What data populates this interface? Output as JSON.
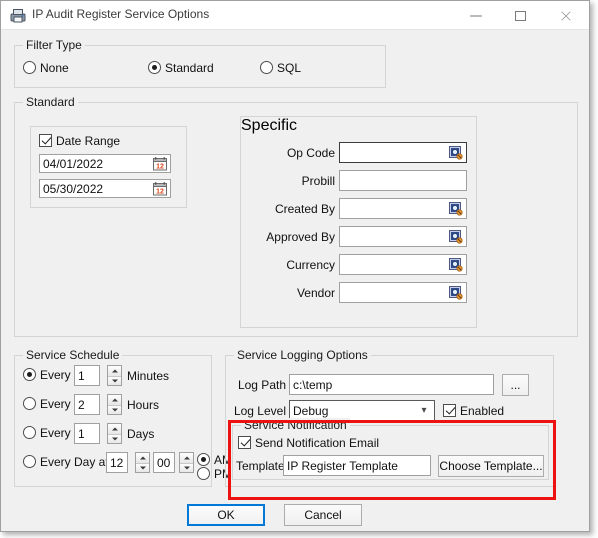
{
  "window": {
    "title": "IP Audit Register Service Options",
    "icon": "printer-icon",
    "minimize_label": "Minimize",
    "maximize_label": "Maximize",
    "close_label": "Close"
  },
  "filter_type": {
    "legend": "Filter Type",
    "options": [
      {
        "label": "None",
        "selected": false
      },
      {
        "label": "Standard",
        "selected": true
      },
      {
        "label": "SQL",
        "selected": false
      }
    ]
  },
  "standard": {
    "legend": "Standard",
    "date_range": {
      "checkbox_label": "Date Range",
      "checked": true,
      "from": "04/01/2022",
      "to": "05/30/2022",
      "icon": "calendar-icon"
    },
    "specific": {
      "legend": "Specific",
      "fields": [
        {
          "label": "Op Code",
          "value": "",
          "icon": "lookup-icon",
          "focused": true
        },
        {
          "label": "Probill",
          "value": "",
          "icon": "",
          "focused": false
        },
        {
          "label": "Created By",
          "value": "",
          "icon": "lookup-icon",
          "focused": false
        },
        {
          "label": "Approved By",
          "value": "",
          "icon": "lookup-icon",
          "focused": false
        },
        {
          "label": "Currency",
          "value": "",
          "icon": "lookup-icon",
          "focused": false
        },
        {
          "label": "Vendor",
          "value": "",
          "icon": "lookup-icon",
          "focused": false
        }
      ]
    }
  },
  "service_schedule": {
    "legend": "Service Schedule",
    "rows": [
      {
        "prefix": "Every",
        "value": "1",
        "unit": "Minutes",
        "selected": true
      },
      {
        "prefix": "Every",
        "value": "2",
        "unit": "Hours",
        "selected": false
      },
      {
        "prefix": "Every",
        "value": "1",
        "unit": "Days",
        "selected": false
      }
    ],
    "every_day": {
      "prefix": "Every Day at",
      "selected": false,
      "hour": "12",
      "minute": "00",
      "am_label": "AM",
      "pm_label": "PM",
      "meridiem": "AM"
    }
  },
  "logging": {
    "legend": "Service Logging Options",
    "log_path_label": "Log Path",
    "log_path_value": "c:\\temp",
    "browse_label": "...",
    "log_level_label": "Log Level",
    "log_level_value": "Debug",
    "enabled_label": "Enabled",
    "enabled_checked": true
  },
  "notification": {
    "legend": "Service Notification",
    "send_email_label": "Send Notification Email",
    "send_email_checked": true,
    "template_label": "Template",
    "template_value": "IP Register Template",
    "choose_label": "Choose Template...",
    "highlight_color": "#ee1111"
  },
  "footer": {
    "ok_label": "OK",
    "cancel_label": "Cancel",
    "focus_color": "#0078d7"
  }
}
